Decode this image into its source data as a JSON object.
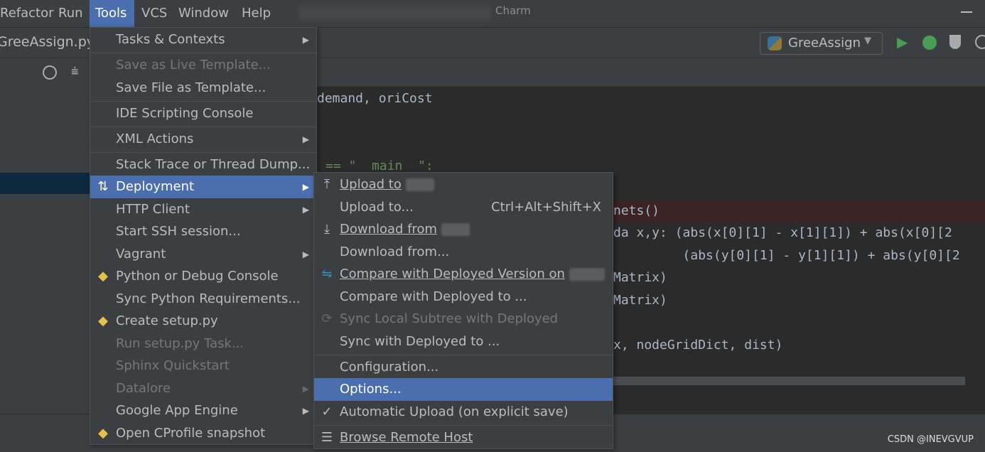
{
  "menubar": {
    "items": [
      "Refactor",
      "Run",
      "Tools",
      "VCS",
      "Window",
      "Help"
    ],
    "active": "Tools",
    "window_title": "Charm"
  },
  "toolbar": {
    "file_tab": "GreeAssign.py",
    "run_config": "GreeAssign",
    "run_icon": "play-icon",
    "debug_icon": "bug-icon",
    "coverage_icon": "shield-run-icon"
  },
  "editor": {
    "lines": [
      "demand, oriCost",
      "== \"__main__\":",
      "nets()",
      "da x,y: (abs(x[0][1] - x[1][1]) + abs(x[0][2",
      "         (abs(y[0][1] - y[1][1]) + abs(y[0][2",
      "Matrix)",
      "Matrix)",
      "x, nodeGridDict, dist)"
    ]
  },
  "tools_menu": {
    "items": [
      {
        "label": "Tasks & Contexts",
        "submenu": true
      },
      {
        "label": "Save as Live Template...",
        "disabled": true
      },
      {
        "label": "Save File as Template..."
      },
      {
        "label": "IDE Scripting Console"
      },
      {
        "label": "XML Actions",
        "submenu": true
      },
      {
        "label": "Stack Trace or Thread Dump..."
      },
      {
        "label": "Deployment",
        "submenu": true,
        "highlighted": true
      },
      {
        "label": "HTTP Client",
        "submenu": true
      },
      {
        "label": "Start SSH session..."
      },
      {
        "label": "Vagrant",
        "submenu": true
      },
      {
        "label": "Python or Debug Console"
      },
      {
        "label": "Sync Python Requirements..."
      },
      {
        "label": "Create setup.py"
      },
      {
        "label": "Run setup.py Task...",
        "disabled": true
      },
      {
        "label": "Sphinx Quickstart",
        "disabled": true
      },
      {
        "label": "Datalore",
        "submenu": true,
        "disabled": true
      },
      {
        "label": "Google App Engine",
        "submenu": true
      },
      {
        "label": "Open CProfile snapshot"
      }
    ]
  },
  "deployment_menu": {
    "items": [
      {
        "label": "Upload to"
      },
      {
        "label": "Upload to...",
        "shortcut": "Ctrl+Alt+Shift+X"
      },
      {
        "label": "Download from"
      },
      {
        "label": "Download from..."
      },
      {
        "label": "Compare with Deployed Version on"
      },
      {
        "label": "Compare with Deployed to ..."
      },
      {
        "label": "Sync Local Subtree with Deployed",
        "disabled": true
      },
      {
        "label": "Sync with Deployed to ..."
      },
      {
        "label": "Configuration..."
      },
      {
        "label": "Options...",
        "highlighted": true
      },
      {
        "label": "Automatic Upload (on explicit save)",
        "checked": true
      },
      {
        "label": "Browse Remote Host"
      }
    ]
  },
  "watermark": "CSDN @INEVGVUP",
  "colors": {
    "highlight": "#4b6eaf",
    "bg": "#3c3f41",
    "editor": "#2b2b2b",
    "run": "#499c54"
  }
}
